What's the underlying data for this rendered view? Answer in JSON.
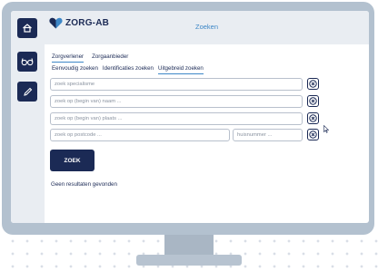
{
  "header": {
    "title": "Zoeken",
    "logo_text": "ZORG-AB"
  },
  "sidebar": {
    "items": [
      {
        "icon": "home-icon"
      },
      {
        "icon": "glasses-icon"
      },
      {
        "icon": "pencil-icon"
      }
    ]
  },
  "tabs_primary": [
    {
      "label": "Zorgverlener",
      "active": true
    },
    {
      "label": "Zorgaanbieder",
      "active": false
    }
  ],
  "tabs_secondary": [
    {
      "label": "Eenvoudig zoeken",
      "active": false
    },
    {
      "label": "Identificaties zoeken",
      "active": false
    },
    {
      "label": "Uitgebreid zoeken",
      "active": true
    }
  ],
  "form": {
    "specialisme_placeholder": "zoek specialisme",
    "naam_placeholder": "zoek op (begin van) naam ...",
    "plaats_placeholder": "zoek op (begin van) plaats ...",
    "postcode_placeholder": "zoek op postcode ...",
    "huisnummer_placeholder": "huisnummer ...",
    "search_label": "ZOEK"
  },
  "results": {
    "message": "Geen resultaten gevonden"
  },
  "colors": {
    "navy": "#1b2a55",
    "accent": "#3d87c7",
    "panel": "#e9edf2"
  }
}
